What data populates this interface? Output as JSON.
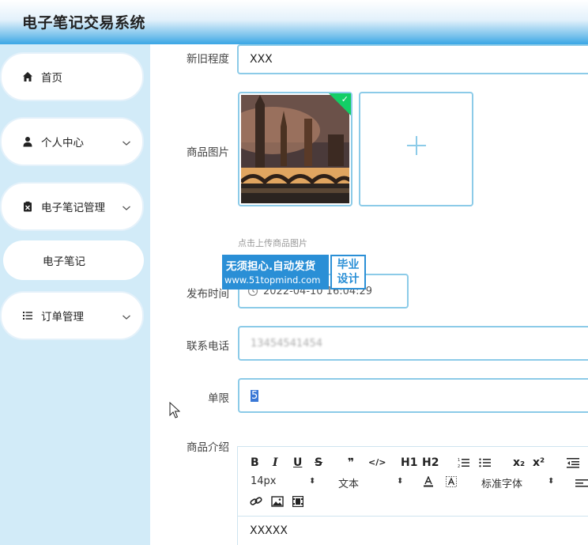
{
  "app": {
    "title": "电子笔记交易系统"
  },
  "sidebar": {
    "items": [
      {
        "label": "首页",
        "icon": "home-icon"
      },
      {
        "label": "个人中心",
        "icon": "user-icon"
      },
      {
        "label": "电子笔记管理",
        "icon": "clipboard-icon"
      },
      {
        "label": "电子笔记",
        "icon": ""
      },
      {
        "label": "订单管理",
        "icon": "list-icon"
      }
    ]
  },
  "form": {
    "condition": {
      "label": "新旧程度",
      "value": "XXX"
    },
    "image": {
      "label": "商品图片",
      "hint": "点击上传商品图片"
    },
    "publish_time": {
      "label": "发布时间",
      "value": "2022-04-10 16:04:29"
    },
    "phone": {
      "label": "联系电话",
      "value": "13454541454"
    },
    "limit": {
      "label": "单限",
      "value": "5"
    },
    "intro": {
      "label": "商品介绍",
      "content": "XXXXX"
    }
  },
  "editor": {
    "font_size": "14px",
    "text_style": "文本",
    "font_family": "标准字体",
    "buttons": [
      "B",
      "I",
      "U",
      "S",
      "❞",
      "</>",
      "H1",
      "H2",
      "ol",
      "ul",
      "x₂",
      "x²",
      "indent"
    ]
  },
  "watermark": {
    "line1": "无须担心.自动发货",
    "line2": "www.51topmind.com",
    "badge1": "毕业",
    "badge2": "设计"
  },
  "colors": {
    "accent": "#3aa6e5",
    "border": "#8ccbe8",
    "sidebar": "#d2ebf8"
  }
}
